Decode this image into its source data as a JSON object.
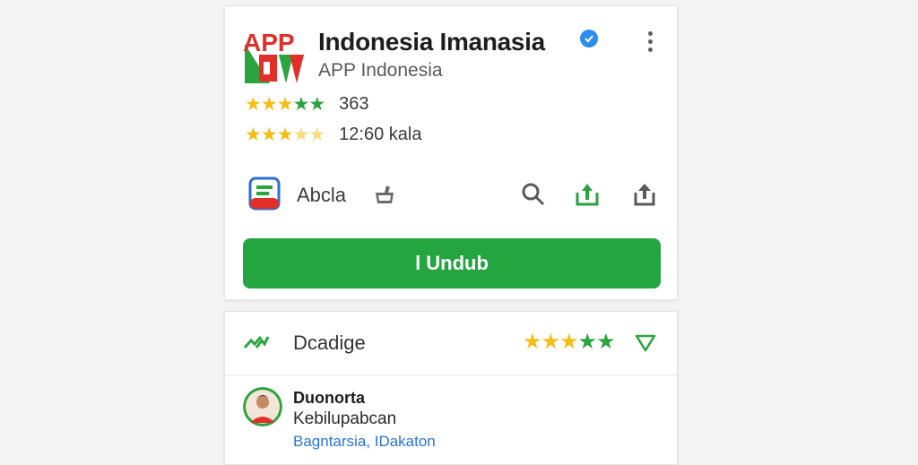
{
  "app": {
    "logo_text": "APP",
    "title": "Indonesia Imanasia",
    "developer": "APP Indonesia"
  },
  "ratings": [
    {
      "stars": [
        "gold",
        "gold",
        "gold",
        "green",
        "green"
      ],
      "text": "363"
    },
    {
      "stars": [
        "gold",
        "gold",
        "gold",
        "pale",
        "pale"
      ],
      "text": "12:60 kala"
    }
  ],
  "actions": {
    "abcla_label": "Abcla",
    "icons": [
      "abcla-app-icon",
      "wishlist-icon",
      "search-icon",
      "install-arrow-icon",
      "share-icon"
    ]
  },
  "download_label": "l Undub",
  "review_section": {
    "title": "Dcadige",
    "stars": [
      "gold",
      "gold",
      "gold",
      "green",
      "green"
    ],
    "reviewer": {
      "name": "Duonorta",
      "text": "Kebilupabcan",
      "link": "Bagntarsia, IDakaton"
    }
  },
  "colors": {
    "accent_green": "#23a53f",
    "star_gold": "#f6bd16",
    "verified_blue": "#2d8cf0",
    "link_blue": "#2b73d6",
    "logo_red": "#e1302a"
  }
}
